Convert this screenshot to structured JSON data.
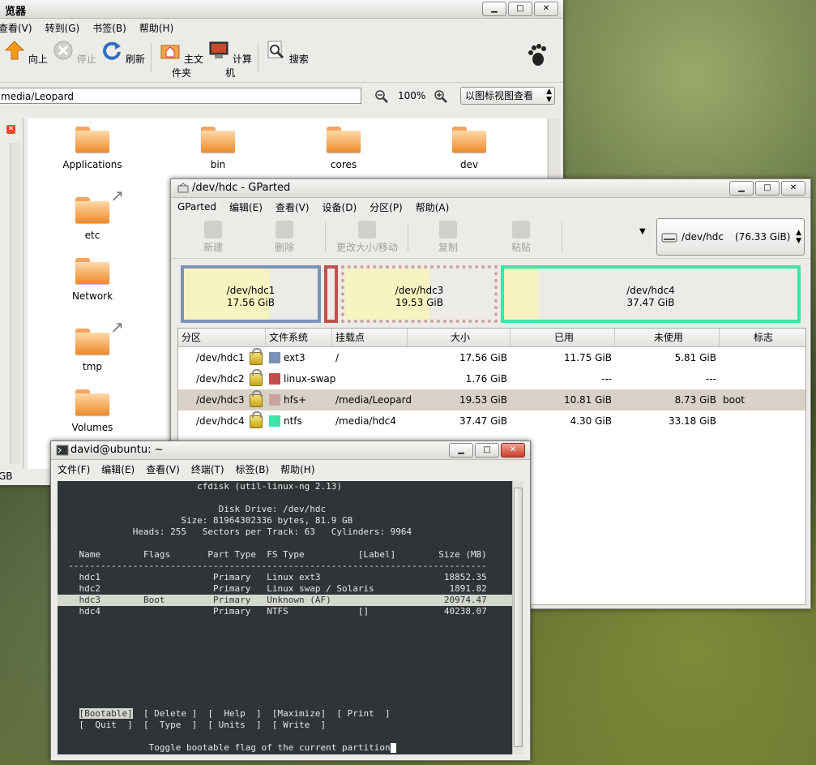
{
  "file_manager": {
    "title": "览器",
    "menu": [
      "查看(V)",
      "转到(G)",
      "书签(B)",
      "帮助(H)"
    ],
    "toolbar": {
      "up": "向上",
      "stop": "停止",
      "refresh": "刷新",
      "home": "主文件夹",
      "computer": "计算机",
      "search": "搜索"
    },
    "location": "media/Leopard",
    "zoom": "100%",
    "view_mode": "以图标视图查看",
    "status": "GB",
    "items": [
      "Applications",
      "bin",
      "cores",
      "dev",
      "etc",
      "Network",
      "tmp",
      "Volumes"
    ]
  },
  "gparted": {
    "title": "/dev/hdc - GParted",
    "menu": [
      "GParted",
      "编辑(E)",
      "查看(V)",
      "设备(D)",
      "分区(P)",
      "帮助(A)"
    ],
    "toolbar": {
      "new": "新建",
      "delete": "删除",
      "resize": "更改大小/移动",
      "copy": "复制",
      "paste": "粘贴"
    },
    "device": {
      "name": "/dev/hdc",
      "size": "(76.33 GiB)"
    },
    "visual": [
      {
        "name": "/dev/hdc1",
        "size": "17.56 GiB"
      },
      {
        "name": "/dev/hdc3",
        "size": "19.53 GiB"
      },
      {
        "name": "/dev/hdc4",
        "size": "37.47 GiB"
      }
    ],
    "columns": [
      "分区",
      "文件系统",
      "挂载点",
      "大小",
      "已用",
      "未使用",
      "标志"
    ],
    "rows": [
      {
        "partition": "/dev/hdc1",
        "fs": "ext3",
        "fs_color": "#7b93b9",
        "mount": "/",
        "size": "17.56 GiB",
        "used": "11.75 GiB",
        "unused": "5.81 GiB",
        "flags": ""
      },
      {
        "partition": "/dev/hdc2",
        "fs": "linux-swap",
        "fs_color": "#c1504c",
        "mount": "",
        "size": "1.76 GiB",
        "used": "---",
        "unused": "---",
        "flags": ""
      },
      {
        "partition": "/dev/hdc3",
        "fs": "hfs+",
        "fs_color": "#c9a49e",
        "mount": "/media/Leopard",
        "size": "19.53 GiB",
        "used": "10.81 GiB",
        "unused": "8.73 GiB",
        "flags": "boot"
      },
      {
        "partition": "/dev/hdc4",
        "fs": "ntfs",
        "fs_color": "#3ee4a8",
        "mount": "/media/hdc4",
        "size": "37.47 GiB",
        "used": "4.30 GiB",
        "unused": "33.18 GiB",
        "flags": ""
      }
    ]
  },
  "terminal": {
    "title": "david@ubuntu: ~",
    "menu": [
      "文件(F)",
      "编辑(E)",
      "查看(V)",
      "终端(T)",
      "标签(B)",
      "帮助(H)"
    ],
    "lines": [
      "                          cfdisk (util-linux-ng 2.13)",
      "",
      "                              Disk Drive: /dev/hdc",
      "                       Size: 81964302336 bytes, 81.9 GB",
      "              Heads: 255   Sectors per Track: 63   Cylinders: 9964",
      "",
      "    Name        Flags       Part Type  FS Type          [Label]        Size (MB)",
      "  ------------------------------------------------------------------------------",
      "    hdc1                     Primary   Linux ext3                       18852.35",
      "    hdc2                     Primary   Linux swap / Solaris              1891.82",
      "    hdc3        Boot         Primary   Unknown (AF)                     20974.47",
      "    hdc4                     Primary   NTFS             []              40238.07"
    ],
    "highlight_index": 10,
    "bootable": "[Bootable]",
    "menu_line1_rest": "  [ Delete ]  [  Help  ]  [Maximize]  [ Print  ]",
    "menu_line2": "    [  Quit  ]  [  Type  ]  [ Units  ]  [ Write  ]",
    "help_text": "                 Toggle bootable flag of the current partition"
  }
}
